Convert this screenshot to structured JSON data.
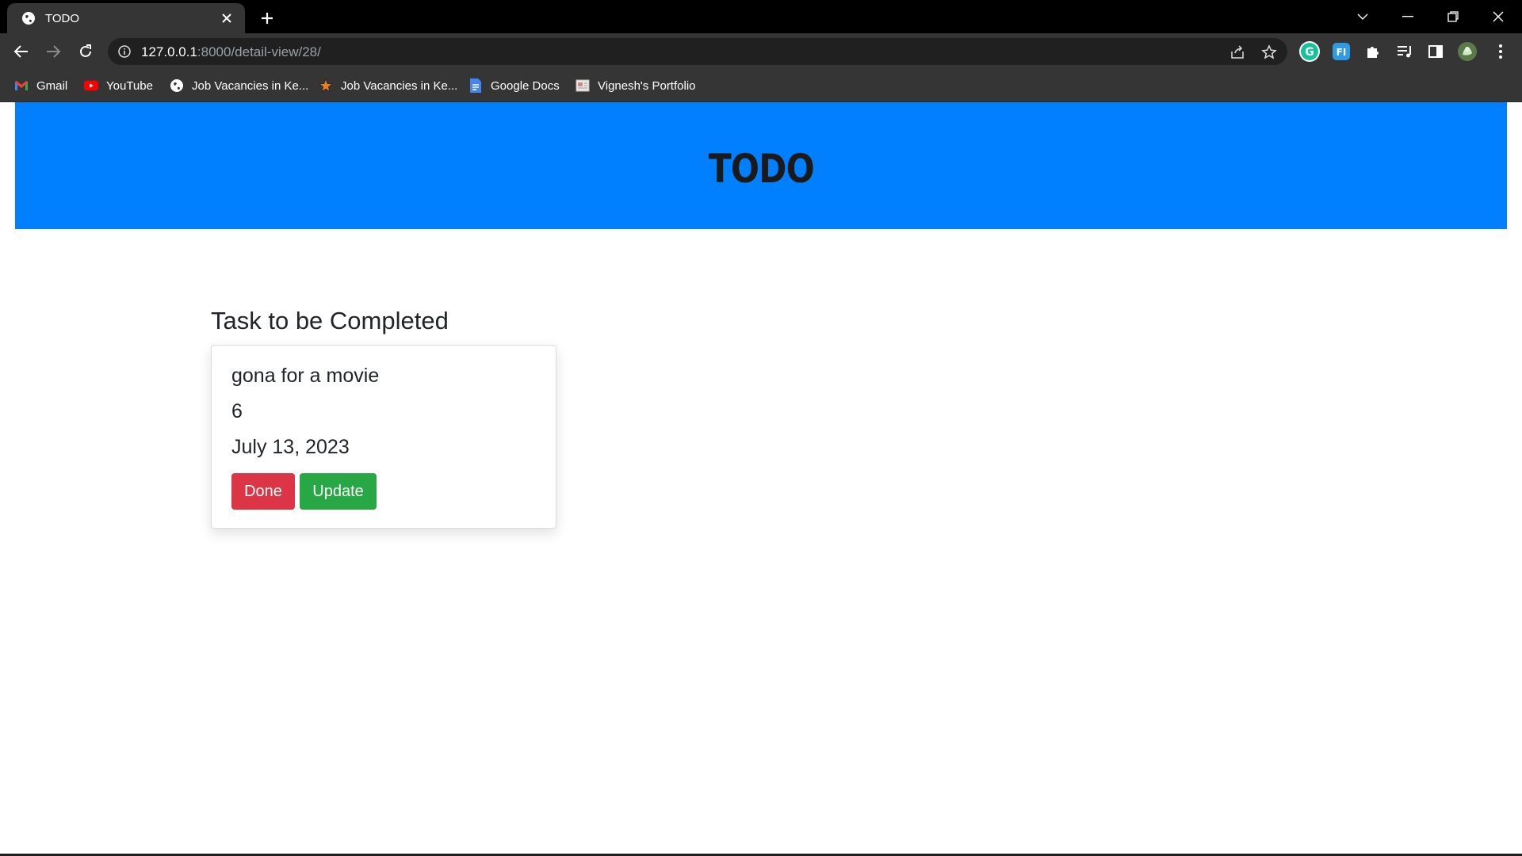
{
  "browser": {
    "tab": {
      "title": "TODO"
    },
    "url": {
      "host": "127.0.0.1",
      "rest": ":8000/detail-view/28/"
    },
    "bookmarks": [
      {
        "label": "Gmail",
        "icon": "gmail-icon"
      },
      {
        "label": "YouTube",
        "icon": "youtube-icon"
      },
      {
        "label": "Job Vacancies in Ke...",
        "icon": "globe-icon"
      },
      {
        "label": "Job Vacancies in Ke...",
        "icon": "star-icon"
      },
      {
        "label": "Google Docs",
        "icon": "google-docs-icon"
      },
      {
        "label": "Vignesh's Portfolio",
        "icon": "portfolio-icon"
      }
    ],
    "extensions": [
      "grammarly-icon",
      "fi-extension-icon",
      "extensions-puzzle-icon",
      "reading-list-icon",
      "side-panel-icon",
      "profile-avatar-icon",
      "menu-kebab-icon"
    ]
  },
  "page": {
    "header": {
      "title": "TODO",
      "background": "#0080ff"
    },
    "section_title": "Task to be Completed",
    "task": {
      "name": "gona for a movie",
      "priority": "6",
      "date": "July 13, 2023"
    },
    "buttons": {
      "done": {
        "label": "Done",
        "color": "#dc3545"
      },
      "update": {
        "label": "Update",
        "color": "#28a745"
      }
    }
  }
}
